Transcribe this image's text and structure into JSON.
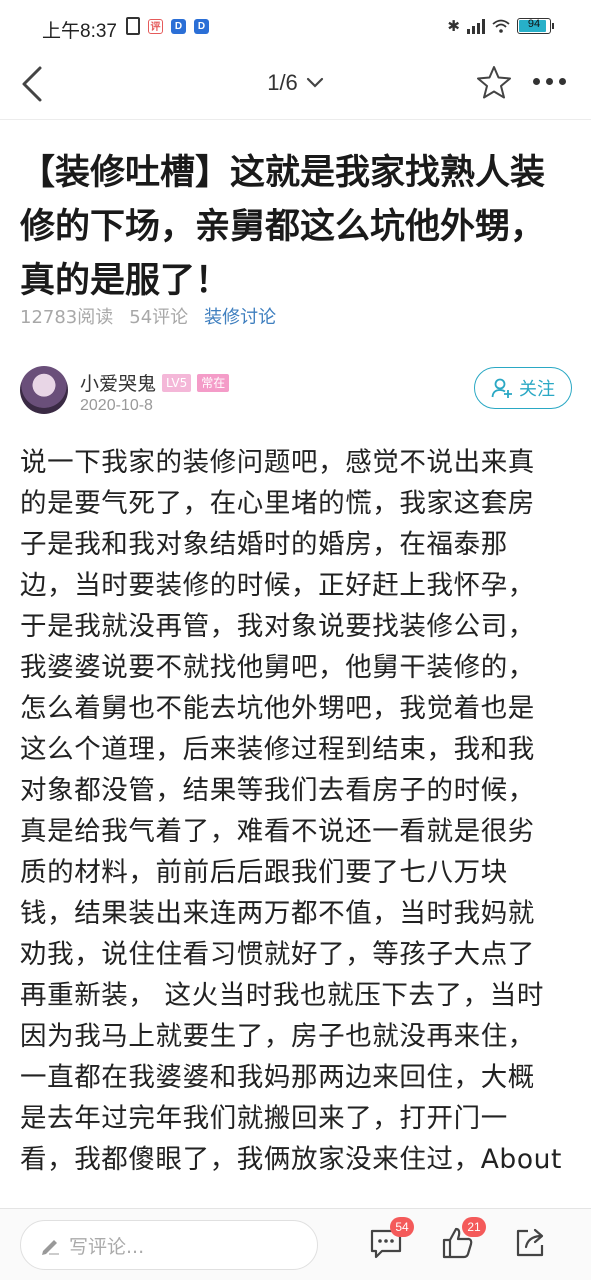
{
  "status_bar": {
    "time": "上午8:37",
    "left_icons": [
      "vibrate-icon",
      "notification-icon",
      "app-d-icon",
      "app-d-icon"
    ],
    "mini_badges": [
      "评",
      "D",
      "D"
    ],
    "right_icons": [
      "bluetooth-icon",
      "signal-icon",
      "sim-icon",
      "wifi-icon",
      "battery-icon"
    ],
    "battery": "94",
    "battery_level": 0.94,
    "colors": {
      "battery_fill": "#27b0c9",
      "app_badge_blue": "#2b6fd6",
      "app_badge_red": "#e55a5a"
    }
  },
  "nav": {
    "page_indicator": "1/6",
    "icons": [
      "back-icon",
      "chevron-down-icon",
      "star-icon",
      "more-icon"
    ]
  },
  "article": {
    "title": "【装修吐槽】这就是我家找熟人装修的下场，亲舅都这么坑他外甥，真的是服了！",
    "reads": "12783阅读",
    "comments": "54评论",
    "topic": "装修讨论",
    "author": {
      "name": "小爱哭鬼",
      "level": "LV5",
      "badge": "常在",
      "date": "2020-10-8",
      "follow_label": "关注"
    },
    "body_lines": [
      "说一下我家的装修问题吧，感觉不说出来真",
      "的是要气死了，在心里堵的慌，我家这套房",
      "子是我和我对象结婚时的婚房，在福泰那",
      "边，当时要装修的时候，正好赶上我怀孕，",
      "于是我就没再管，我对象说要找装修公司，",
      "我婆婆说要不就找他舅吧，他舅干装修的，",
      "怎么着舅也不能去坑他外甥吧，我觉着也是",
      "这么个道理，后来装修过程到结束，我和我",
      "对象都没管，结果等我们去看房子的时候，",
      "真是给我气着了，难看不说还一看就是很劣",
      "质的材料，前前后后跟我们要了七八万块",
      "钱，结果装出来连两万都不值，当时我妈就",
      "劝我，说住住看习惯就好了，等孩子大点了",
      "再重新装， 这火当时我也就压下去了，当时",
      "因为我马上就要生了，房子也就没再来住，",
      "一直都在我婆婆和我妈那两边来回住，大概",
      "是去年过完年我们就搬回来了，打开门一",
      "看，我都傻眼了，我俩放家没来住过，About"
    ]
  },
  "bottom_bar": {
    "comment_placeholder": "写评论...",
    "comment_count": "54",
    "like_count": "21",
    "icons": [
      "pencil-icon",
      "comment-icon",
      "thumbs-up-icon",
      "share-icon"
    ],
    "colors": {
      "badge": "#f45a5a",
      "accent": "#2aa8c4"
    }
  }
}
